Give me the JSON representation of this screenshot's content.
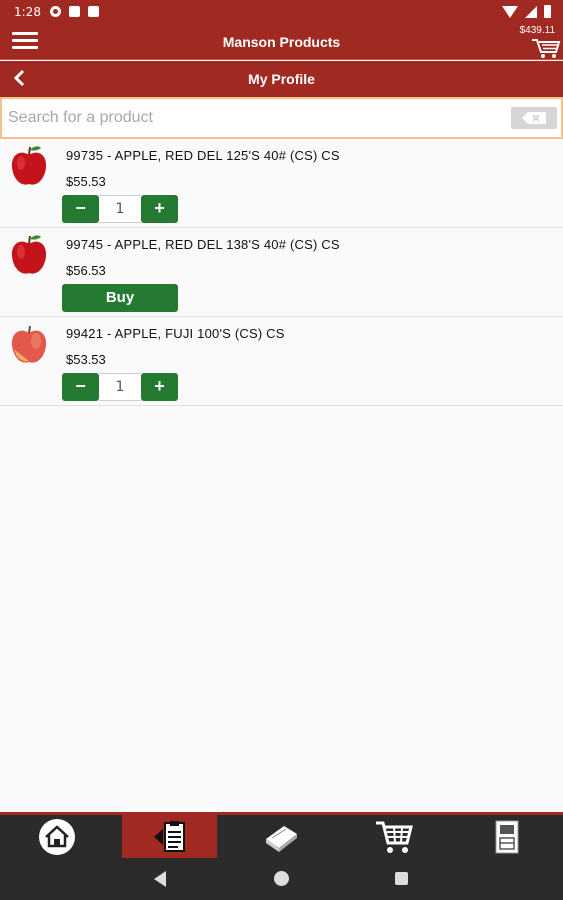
{
  "status_bar": {
    "time": "1:28"
  },
  "app_bar": {
    "title": "Manson Products",
    "cart_total": "$439.11"
  },
  "page_bar": {
    "title": "My Profile"
  },
  "search": {
    "placeholder": "Search for a product",
    "value": ""
  },
  "products": [
    {
      "name": "99735 - APPLE, RED DEL 125'S 40# (CS) CS",
      "price": "$55.53",
      "qty": "1",
      "icon": "red-delicious-apple-icon",
      "minus": "−",
      "plus": "+"
    },
    {
      "name": "99745 - APPLE, RED DEL 138'S 40# (CS) CS",
      "price": "$56.53",
      "buy_label": "Buy",
      "icon": "red-delicious-apple-icon"
    },
    {
      "name": "99421 - APPLE, FUJI 100'S (CS) CS",
      "price": "$53.53",
      "qty": "1",
      "icon": "fuji-apple-icon",
      "minus": "−",
      "plus": "+"
    }
  ],
  "bottom_nav": [
    {
      "icon": "home-icon",
      "active": false
    },
    {
      "icon": "order-guide-icon",
      "active": true
    },
    {
      "icon": "catalog-book-icon",
      "active": false
    },
    {
      "icon": "cart-icon",
      "active": false
    },
    {
      "icon": "account-icon",
      "active": false
    }
  ],
  "colors": {
    "brand": "#a02a22",
    "button_green": "#237a30",
    "nav_dark": "#2b2b2b"
  }
}
